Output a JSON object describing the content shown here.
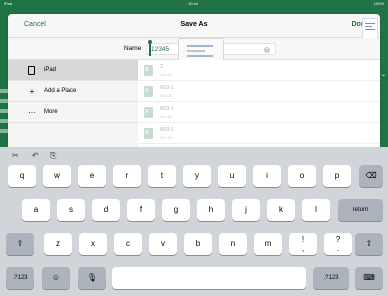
{
  "status_bar": {
    "left": "iPad",
    "center": "10:44",
    "right": "100%"
  },
  "dialog": {
    "cancel_label": "Cancel",
    "title": "Save As",
    "done_label": "Done"
  },
  "name_field": {
    "label": "Name",
    "value": "12345",
    "clear_icon": "clear-icon"
  },
  "locations": [
    {
      "label": "iPad",
      "icon": "ipad-icon"
    },
    {
      "label": "Add a Place",
      "icon": "plus-icon"
    },
    {
      "label": "More",
      "icon": "more-icon"
    }
  ],
  "files": [
    {
      "name": "2",
      "date": "Oct 26"
    },
    {
      "name": "663-1",
      "date": "Oct 26"
    },
    {
      "name": "663-1",
      "date": "Oct 26"
    },
    {
      "name": "663-1",
      "date": "Oct 26"
    }
  ],
  "keyboard": {
    "toolbar_icons": [
      "cut-icon",
      "undo-icon",
      "paste-icon"
    ],
    "row1": [
      "q",
      "w",
      "e",
      "r",
      "t",
      "y",
      "u",
      "i",
      "o",
      "p"
    ],
    "row2": [
      "a",
      "s",
      "d",
      "f",
      "g",
      "h",
      "j",
      "k",
      "l"
    ],
    "row3": [
      "z",
      "x",
      "c",
      "v",
      "b",
      "n",
      "m",
      "!\n,",
      "?\n."
    ],
    "return_label": "return",
    "numbers_label": ".?123",
    "accent_color": "#217346"
  }
}
